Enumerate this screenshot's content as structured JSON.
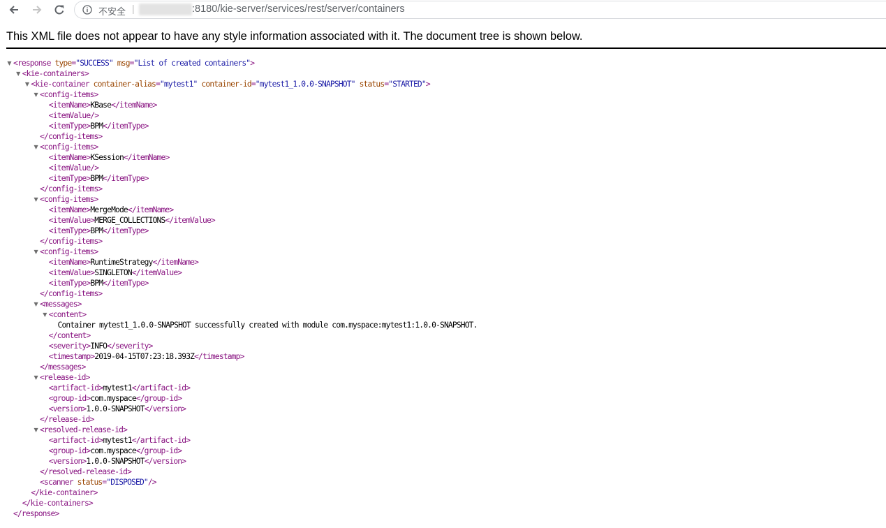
{
  "browser": {
    "security_label": "不安全",
    "separator": "|",
    "url_visible": ":8180/kie-server/services/rest/server/containers"
  },
  "notice": "This XML file does not appear to have any style information associated with it. The document tree is shown below.",
  "colors": {
    "tag": "#881280",
    "attr_name": "#994500",
    "attr_value": "#1a1aa6",
    "text": "#000000"
  },
  "xml_tree": [
    {
      "depth": 0,
      "toggle": true,
      "parts": [
        [
          "t",
          "<response"
        ],
        [
          "n",
          " type"
        ],
        [
          "t",
          "="
        ],
        [
          "v",
          "\"SUCCESS\""
        ],
        [
          "n",
          " msg"
        ],
        [
          "t",
          "="
        ],
        [
          "v",
          "\"List of created containers\""
        ],
        [
          "t",
          ">"
        ]
      ]
    },
    {
      "depth": 1,
      "toggle": true,
      "parts": [
        [
          "t",
          "<kie-containers>"
        ]
      ]
    },
    {
      "depth": 2,
      "toggle": true,
      "parts": [
        [
          "t",
          "<kie-container"
        ],
        [
          "n",
          " container-alias"
        ],
        [
          "t",
          "="
        ],
        [
          "v",
          "\"mytest1\""
        ],
        [
          "n",
          " container-id"
        ],
        [
          "t",
          "="
        ],
        [
          "v",
          "\"mytest1_1.0.0-SNAPSHOT\""
        ],
        [
          "n",
          " status"
        ],
        [
          "t",
          "="
        ],
        [
          "v",
          "\"STARTED\""
        ],
        [
          "t",
          ">"
        ]
      ]
    },
    {
      "depth": 3,
      "toggle": true,
      "parts": [
        [
          "t",
          "<config-items>"
        ]
      ]
    },
    {
      "depth": 4,
      "toggle": false,
      "parts": [
        [
          "t",
          "<itemName>"
        ],
        [
          "x",
          "KBase"
        ],
        [
          "t",
          "</itemName>"
        ]
      ]
    },
    {
      "depth": 4,
      "toggle": false,
      "parts": [
        [
          "t",
          "<itemValue/>"
        ]
      ]
    },
    {
      "depth": 4,
      "toggle": false,
      "parts": [
        [
          "t",
          "<itemType>"
        ],
        [
          "x",
          "BPM"
        ],
        [
          "t",
          "</itemType>"
        ]
      ]
    },
    {
      "depth": 3,
      "toggle": false,
      "parts": [
        [
          "t",
          "</config-items>"
        ]
      ]
    },
    {
      "depth": 3,
      "toggle": true,
      "parts": [
        [
          "t",
          "<config-items>"
        ]
      ]
    },
    {
      "depth": 4,
      "toggle": false,
      "parts": [
        [
          "t",
          "<itemName>"
        ],
        [
          "x",
          "KSession"
        ],
        [
          "t",
          "</itemName>"
        ]
      ]
    },
    {
      "depth": 4,
      "toggle": false,
      "parts": [
        [
          "t",
          "<itemValue/>"
        ]
      ]
    },
    {
      "depth": 4,
      "toggle": false,
      "parts": [
        [
          "t",
          "<itemType>"
        ],
        [
          "x",
          "BPM"
        ],
        [
          "t",
          "</itemType>"
        ]
      ]
    },
    {
      "depth": 3,
      "toggle": false,
      "parts": [
        [
          "t",
          "</config-items>"
        ]
      ]
    },
    {
      "depth": 3,
      "toggle": true,
      "parts": [
        [
          "t",
          "<config-items>"
        ]
      ]
    },
    {
      "depth": 4,
      "toggle": false,
      "parts": [
        [
          "t",
          "<itemName>"
        ],
        [
          "x",
          "MergeMode"
        ],
        [
          "t",
          "</itemName>"
        ]
      ]
    },
    {
      "depth": 4,
      "toggle": false,
      "parts": [
        [
          "t",
          "<itemValue>"
        ],
        [
          "x",
          "MERGE_COLLECTIONS"
        ],
        [
          "t",
          "</itemValue>"
        ]
      ]
    },
    {
      "depth": 4,
      "toggle": false,
      "parts": [
        [
          "t",
          "<itemType>"
        ],
        [
          "x",
          "BPM"
        ],
        [
          "t",
          "</itemType>"
        ]
      ]
    },
    {
      "depth": 3,
      "toggle": false,
      "parts": [
        [
          "t",
          "</config-items>"
        ]
      ]
    },
    {
      "depth": 3,
      "toggle": true,
      "parts": [
        [
          "t",
          "<config-items>"
        ]
      ]
    },
    {
      "depth": 4,
      "toggle": false,
      "parts": [
        [
          "t",
          "<itemName>"
        ],
        [
          "x",
          "RuntimeStrategy"
        ],
        [
          "t",
          "</itemName>"
        ]
      ]
    },
    {
      "depth": 4,
      "toggle": false,
      "parts": [
        [
          "t",
          "<itemValue>"
        ],
        [
          "x",
          "SINGLETON"
        ],
        [
          "t",
          "</itemValue>"
        ]
      ]
    },
    {
      "depth": 4,
      "toggle": false,
      "parts": [
        [
          "t",
          "<itemType>"
        ],
        [
          "x",
          "BPM"
        ],
        [
          "t",
          "</itemType>"
        ]
      ]
    },
    {
      "depth": 3,
      "toggle": false,
      "parts": [
        [
          "t",
          "</config-items>"
        ]
      ]
    },
    {
      "depth": 3,
      "toggle": true,
      "parts": [
        [
          "t",
          "<messages>"
        ]
      ]
    },
    {
      "depth": 4,
      "toggle": true,
      "parts": [
        [
          "t",
          "<content>"
        ]
      ]
    },
    {
      "depth": 5,
      "toggle": false,
      "parts": [
        [
          "x",
          "Container mytest1_1.0.0-SNAPSHOT successfully created with module com.myspace:mytest1:1.0.0-SNAPSHOT."
        ]
      ]
    },
    {
      "depth": 4,
      "toggle": false,
      "parts": [
        [
          "t",
          "</content>"
        ]
      ]
    },
    {
      "depth": 4,
      "toggle": false,
      "parts": [
        [
          "t",
          "<severity>"
        ],
        [
          "x",
          "INFO"
        ],
        [
          "t",
          "</severity>"
        ]
      ]
    },
    {
      "depth": 4,
      "toggle": false,
      "parts": [
        [
          "t",
          "<timestamp>"
        ],
        [
          "x",
          "2019-04-15T07:23:18.393Z"
        ],
        [
          "t",
          "</timestamp>"
        ]
      ]
    },
    {
      "depth": 3,
      "toggle": false,
      "parts": [
        [
          "t",
          "</messages>"
        ]
      ]
    },
    {
      "depth": 3,
      "toggle": true,
      "parts": [
        [
          "t",
          "<release-id>"
        ]
      ]
    },
    {
      "depth": 4,
      "toggle": false,
      "parts": [
        [
          "t",
          "<artifact-id>"
        ],
        [
          "x",
          "mytest1"
        ],
        [
          "t",
          "</artifact-id>"
        ]
      ]
    },
    {
      "depth": 4,
      "toggle": false,
      "parts": [
        [
          "t",
          "<group-id>"
        ],
        [
          "x",
          "com.myspace"
        ],
        [
          "t",
          "</group-id>"
        ]
      ]
    },
    {
      "depth": 4,
      "toggle": false,
      "parts": [
        [
          "t",
          "<version>"
        ],
        [
          "x",
          "1.0.0-SNAPSHOT"
        ],
        [
          "t",
          "</version>"
        ]
      ]
    },
    {
      "depth": 3,
      "toggle": false,
      "parts": [
        [
          "t",
          "</release-id>"
        ]
      ]
    },
    {
      "depth": 3,
      "toggle": true,
      "parts": [
        [
          "t",
          "<resolved-release-id>"
        ]
      ]
    },
    {
      "depth": 4,
      "toggle": false,
      "parts": [
        [
          "t",
          "<artifact-id>"
        ],
        [
          "x",
          "mytest1"
        ],
        [
          "t",
          "</artifact-id>"
        ]
      ]
    },
    {
      "depth": 4,
      "toggle": false,
      "parts": [
        [
          "t",
          "<group-id>"
        ],
        [
          "x",
          "com.myspace"
        ],
        [
          "t",
          "</group-id>"
        ]
      ]
    },
    {
      "depth": 4,
      "toggle": false,
      "parts": [
        [
          "t",
          "<version>"
        ],
        [
          "x",
          "1.0.0-SNAPSHOT"
        ],
        [
          "t",
          "</version>"
        ]
      ]
    },
    {
      "depth": 3,
      "toggle": false,
      "parts": [
        [
          "t",
          "</resolved-release-id>"
        ]
      ]
    },
    {
      "depth": 3,
      "toggle": false,
      "parts": [
        [
          "t",
          "<scanner"
        ],
        [
          "n",
          " status"
        ],
        [
          "t",
          "="
        ],
        [
          "v",
          "\"DISPOSED\""
        ],
        [
          "t",
          "/>"
        ]
      ]
    },
    {
      "depth": 2,
      "toggle": false,
      "parts": [
        [
          "t",
          "</kie-container>"
        ]
      ]
    },
    {
      "depth": 1,
      "toggle": false,
      "parts": [
        [
          "t",
          "</kie-containers>"
        ]
      ]
    },
    {
      "depth": 0,
      "toggle": false,
      "parts": [
        [
          "t",
          "</response>"
        ]
      ]
    }
  ]
}
